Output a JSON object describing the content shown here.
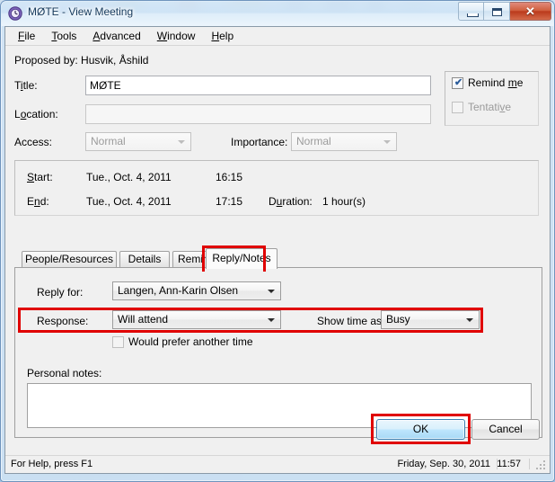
{
  "window": {
    "title": "MØTE - View Meeting",
    "icon": "clock-icon",
    "minimize_label": "Minimize",
    "maximize_label": "Maximize",
    "close_label": "✕"
  },
  "menubar": {
    "items": [
      {
        "label": "File",
        "accel": "F"
      },
      {
        "label": "Tools",
        "accel": "T"
      },
      {
        "label": "Advanced",
        "accel": "A"
      },
      {
        "label": "Window",
        "accel": "W"
      },
      {
        "label": "Help",
        "accel": "H"
      }
    ]
  },
  "form": {
    "proposed_by": "Proposed by: Husvik, Åshild",
    "title_label": "Title:",
    "title_value": "MØTE",
    "location_label": "Location:",
    "location_value": "",
    "access_label": "Access:",
    "access_value": "Normal",
    "importance_label": "Importance:",
    "importance_value": "Normal",
    "remind_me_label": "Remind me",
    "remind_me_checked": true,
    "tentative_label": "Tentative",
    "tentative_checked": false,
    "tentative_disabled": true
  },
  "schedule": {
    "start_label": "Start:",
    "start_date": "Tue., Oct. 4, 2011",
    "start_time": "16:15",
    "end_label": "End:",
    "end_date": "Tue., Oct. 4, 2011",
    "end_time": "17:15",
    "duration_label": "Duration:",
    "duration_value": "1 hour(s)"
  },
  "tabs": {
    "items": [
      {
        "label": "People/Resources",
        "active": false
      },
      {
        "label": "Details",
        "active": false
      },
      {
        "label": "Reminders",
        "active": false
      },
      {
        "label": "Reply/Notes",
        "active": true
      }
    ]
  },
  "reply_tab": {
    "reply_for_label": "Reply for:",
    "reply_for_value": "Langen, Ann-Karin Olsen",
    "response_label": "Response:",
    "response_value": "Will attend",
    "show_time_as_label": "Show time as:",
    "show_time_as_value": "Busy",
    "prefer_another_time_label": "Would prefer another time",
    "prefer_another_time_checked": false,
    "personal_notes_label": "Personal notes:",
    "personal_notes_value": ""
  },
  "footer": {
    "ok_label": "OK",
    "cancel_label": "Cancel"
  },
  "statusbar": {
    "help_text": "For Help, press F1",
    "date": "Friday, Sep. 30, 2011",
    "time": "11:57"
  },
  "highlights": {
    "accent_color": "#e00000",
    "regions": [
      "reply-notes-tab",
      "response-row",
      "ok-button"
    ]
  }
}
